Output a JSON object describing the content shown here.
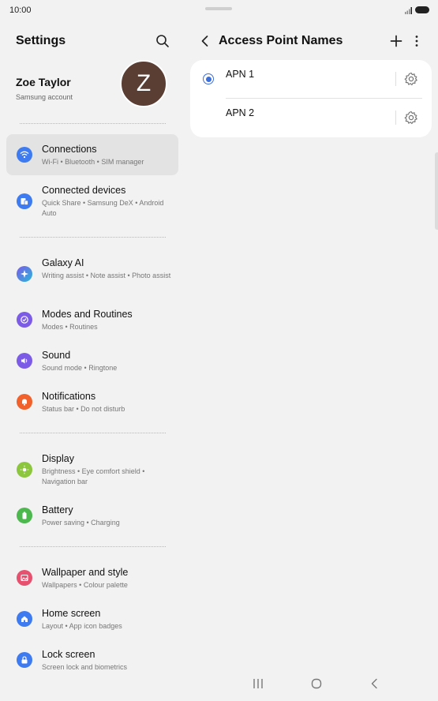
{
  "status": {
    "time": "10:00"
  },
  "left": {
    "title": "Settings",
    "profile": {
      "name": "Zoe Taylor",
      "sub": "Samsung account",
      "initial": "Z"
    },
    "items": [
      {
        "title": "Connections",
        "sub": "Wi-Fi  •  Bluetooth  •  SIM manager",
        "icon": "wifi-icon",
        "color": "#3e7bf0"
      },
      {
        "title": "Connected devices",
        "sub": "Quick Share  •  Samsung DeX  •  Android Auto",
        "icon": "devices-icon",
        "color": "#3e7bf0"
      },
      {
        "title": "Galaxy AI",
        "sub": "Writing assist  •  Note assist  •  Photo assist",
        "icon": "sparkle-icon",
        "color": "#3a8be0"
      },
      {
        "title": "Modes and Routines",
        "sub": "Modes  •  Routines",
        "icon": "check-circle-icon",
        "color": "#7c5ce6"
      },
      {
        "title": "Sound",
        "sub": "Sound mode  •  Ringtone",
        "icon": "speaker-icon",
        "color": "#7c5ce6"
      },
      {
        "title": "Notifications",
        "sub": "Status bar  •  Do not disturb",
        "icon": "bell-icon",
        "color": "#f0612b"
      },
      {
        "title": "Display",
        "sub": "Brightness  •  Eye comfort shield  •  Navigation bar",
        "icon": "sun-icon",
        "color": "#8cc63e"
      },
      {
        "title": "Battery",
        "sub": "Power saving  •  Charging",
        "icon": "battery-icon",
        "color": "#4cb84e"
      },
      {
        "title": "Wallpaper and style",
        "sub": "Wallpapers  •  Colour palette",
        "icon": "image-icon",
        "color": "#e5516e"
      },
      {
        "title": "Home screen",
        "sub": "Layout  •  App icon badges",
        "icon": "home-icon",
        "color": "#3e7bf0"
      },
      {
        "title": "Lock screen",
        "sub": "Screen lock and biometrics",
        "icon": "lock-icon",
        "color": "#3e7bf0"
      }
    ]
  },
  "right": {
    "title": "Access Point Names",
    "apns": [
      {
        "name": "APN 1",
        "selected": true
      },
      {
        "name": "APN 2",
        "selected": false
      }
    ]
  },
  "colors": {
    "accent": "#3d6fd9",
    "active_bg": "#e3e3e3",
    "avatar": "#5a3d33"
  }
}
